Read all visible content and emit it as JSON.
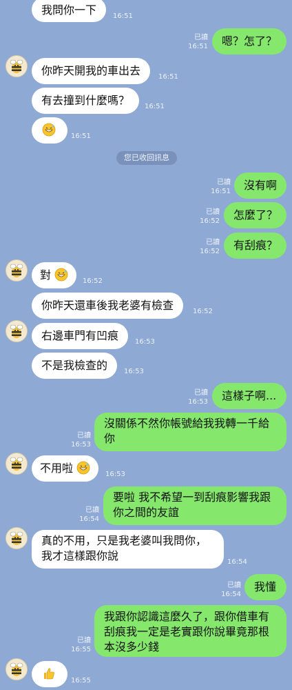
{
  "system_notice": "您已收回訊息",
  "read_label": "已讀",
  "messages": [
    {
      "text": "我問你一下",
      "time": "16:51"
    },
    {
      "text": "嗯？怎了？",
      "time": "16:51"
    },
    {
      "text": "你昨天開我的車出去",
      "time": "16:51"
    },
    {
      "text": "有去撞到什麼嗎？",
      "time": "16:51"
    },
    {
      "emoji": "grinning-sweat-emoji",
      "time": "16:51"
    },
    {
      "text": "沒有啊",
      "time": "16:51"
    },
    {
      "text": "怎麼了？",
      "time": "16:52"
    },
    {
      "text": "有刮痕？",
      "time": "16:52"
    },
    {
      "text": "對",
      "emoji": "grinning-sweat-emoji",
      "time": "16:52"
    },
    {
      "text": "你昨天還車後我老婆有檢查",
      "time": "16:52"
    },
    {
      "text": "右邊車門有凹痕",
      "time": "16:53"
    },
    {
      "text": "不是我檢查的",
      "time": "16:53"
    },
    {
      "text": "這樣子啊...",
      "time": "16:53"
    },
    {
      "text": "沒關係不然你帳號給我我轉一千給你",
      "time": "16:53"
    },
    {
      "text": "不用啦",
      "emoji": "grinning-sweat-emoji",
      "time": "16:53"
    },
    {
      "text": "要啦 我不希望一到刮痕影響我跟你之間的友誼",
      "time": "16:54"
    },
    {
      "text": "真的不用，只是我老婆叫我問你，我才這樣跟你說",
      "time": "16:54"
    },
    {
      "text": "我懂",
      "time": "16:54"
    },
    {
      "text": "我跟你認識這麼久了，跟你借車有刮痕我一定是老實跟你說畢竟那根本沒多少錢",
      "time": "16:55"
    },
    {
      "emoji": "thumbs-up-emoji",
      "time": "16:55"
    }
  ],
  "colors": {
    "background": "#8ea9d4",
    "incoming_bubble": "#ffffff",
    "outgoing_bubble": "#85e86d"
  },
  "icons": {
    "avatar": "bee-avatar-icon"
  }
}
